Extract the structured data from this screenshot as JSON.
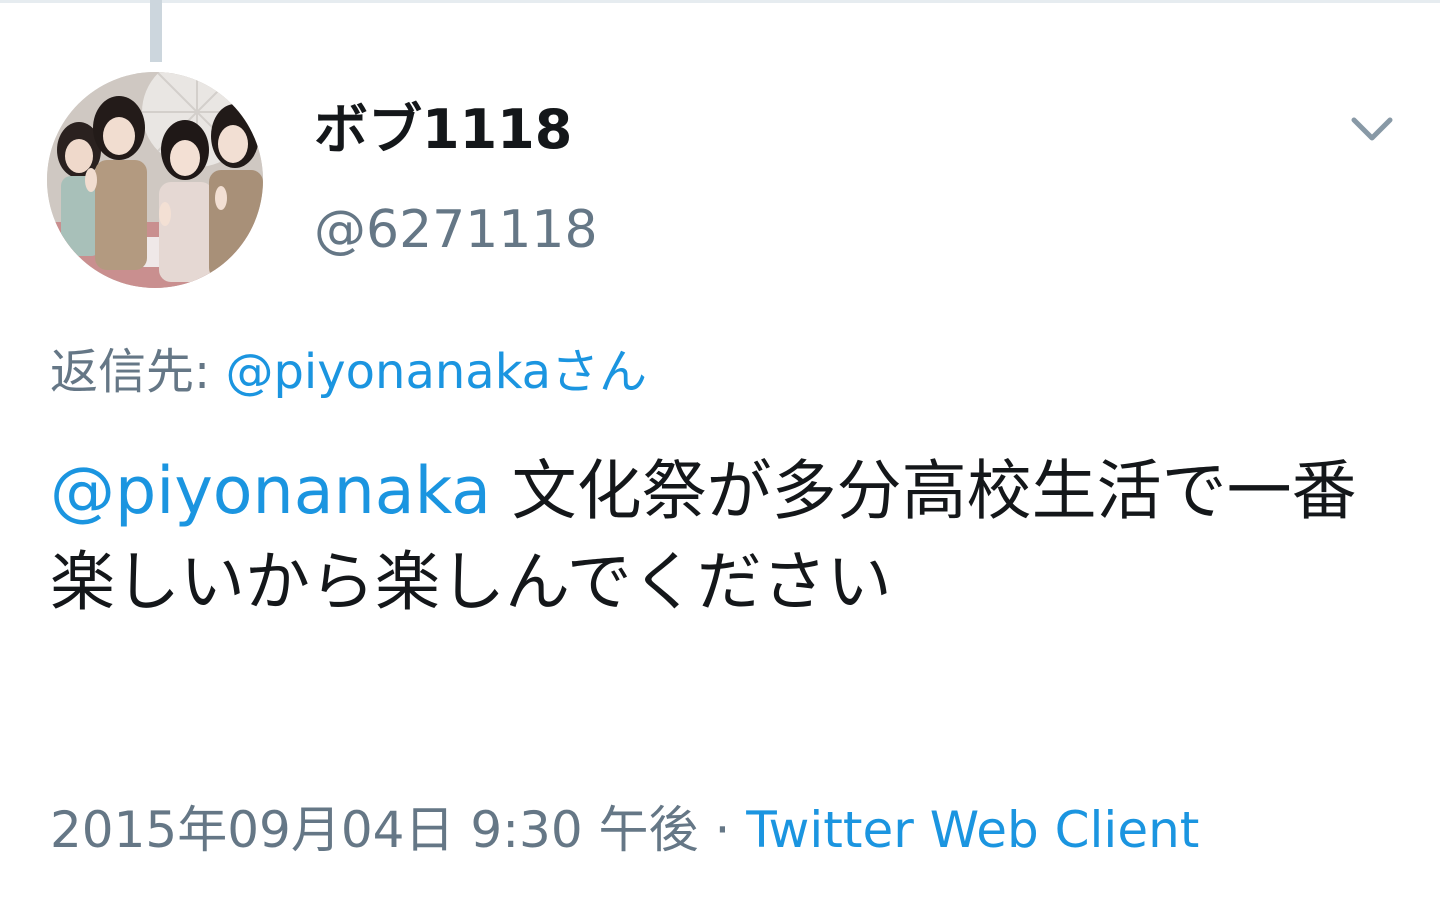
{
  "tweet": {
    "author": {
      "display_name": "ボブ1118",
      "handle": "@6271118",
      "avatar": "group-photo-avatar"
    },
    "menu_icon": "chevron-down-icon",
    "reply_to": {
      "prefix": "返信先: ",
      "target": "@piyonanakaさん"
    },
    "text": {
      "mention": "@piyonanaka",
      "body": " 文化祭が多分高校生活で一番楽しいから楽しんでください"
    },
    "meta": {
      "timestamp": "2015年09月04日 9:30 午後",
      "separator": " · ",
      "client": "Twitter Web Client"
    },
    "colors": {
      "link": "#1b95e0",
      "secondary_text": "#657786",
      "primary_text": "#14171a",
      "thread_line": "#ccd6dd"
    }
  }
}
